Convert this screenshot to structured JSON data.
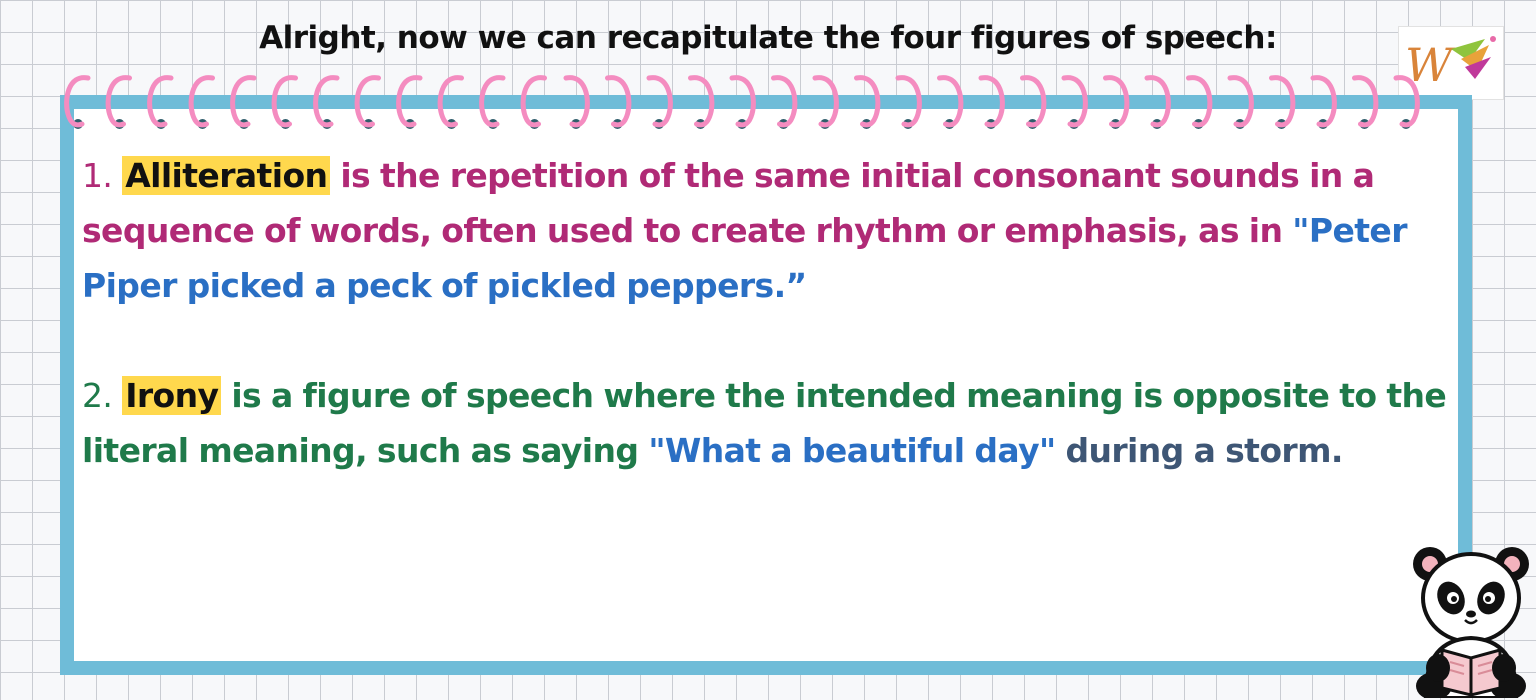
{
  "heading": "Alright, now we can recapitulate the four figures of speech:",
  "item1": {
    "number": "1.",
    "term": "Alliteration",
    "definition": "is the repetition of the same initial consonant sounds in a sequence of words, often used to create rhythm or emphasis, as in",
    "example": "\"Peter Piper picked a peck of pickled peppers.”"
  },
  "item2": {
    "number": "2.",
    "term": "Irony",
    "definition": "is a figure of speech where the intended meaning is opposite to the literal meaning, such as saying",
    "example": "\"What a beautiful day\"",
    "suffix": "during a storm."
  },
  "colors": {
    "card_border": "#6fbcd8",
    "spiral": "#f48cc0",
    "highlight": "#ffd84d",
    "item1_text": "#b02a76",
    "item2_text": "#1f7a4a",
    "example_text": "#2a6fc4",
    "suffix_text": "#3e5675"
  },
  "icons": [
    "w-logo-icon",
    "spiral-binding-icon",
    "panda-reading-icon"
  ]
}
